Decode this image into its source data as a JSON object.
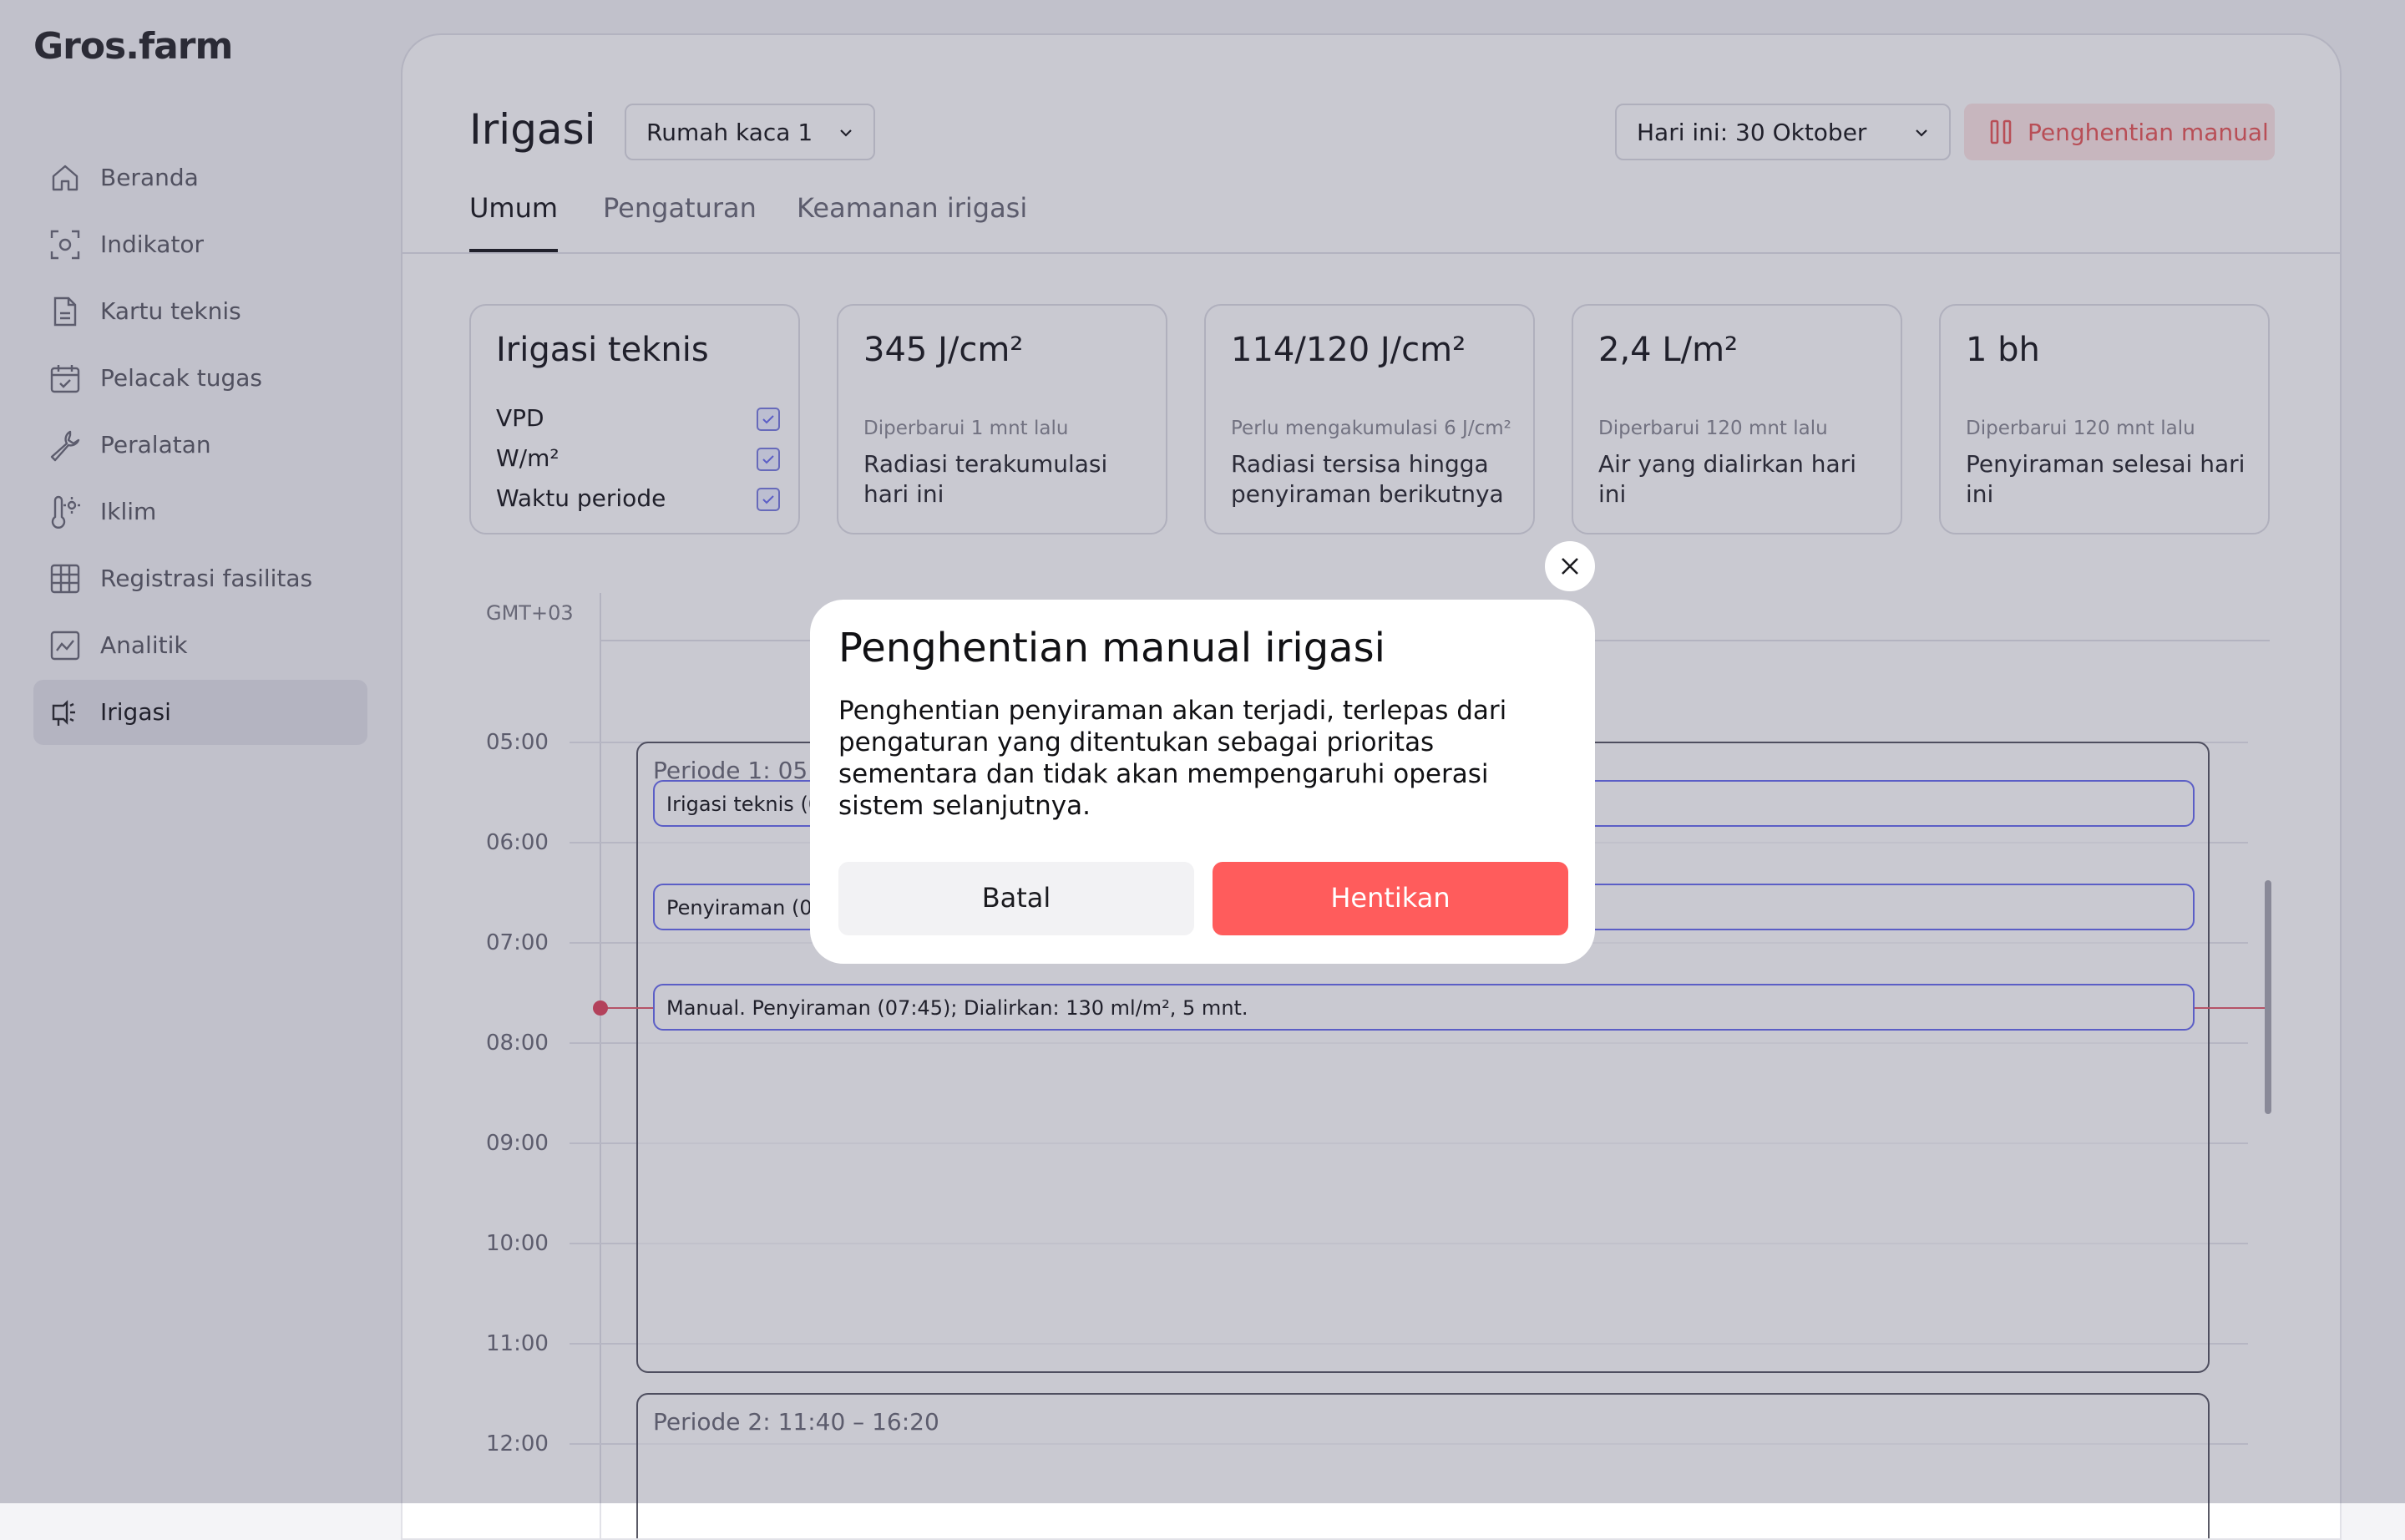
{
  "app": {
    "logo": "Gros.farm"
  },
  "sidebar": {
    "items": [
      {
        "label": "Beranda",
        "icon": "home-icon"
      },
      {
        "label": "Indikator",
        "icon": "sensor-icon"
      },
      {
        "label": "Kartu teknis",
        "icon": "document-icon"
      },
      {
        "label": "Pelacak tugas",
        "icon": "calendar-check-icon"
      },
      {
        "label": "Peralatan",
        "icon": "wrench-icon"
      },
      {
        "label": "Iklim",
        "icon": "thermometer-icon"
      },
      {
        "label": "Registrasi fasilitas",
        "icon": "grid-icon"
      },
      {
        "label": "Analitik",
        "icon": "chart-icon"
      },
      {
        "label": "Irigasi",
        "icon": "sprinkler-icon",
        "active": true
      }
    ]
  },
  "header": {
    "title": "Irigasi",
    "greenhouse_select": "Rumah kaca 1",
    "date_select": "Hari ini: 30 Oktober",
    "manual_stop_label": "Penghentian manual"
  },
  "tabs": [
    {
      "label": "Umum",
      "active": true
    },
    {
      "label": "Pengaturan"
    },
    {
      "label": "Keamanan irigasi"
    }
  ],
  "cards": {
    "tech": {
      "title": "Irigasi teknis",
      "items": [
        {
          "label": "VPD",
          "checked": true
        },
        {
          "label": "W/m²",
          "checked": true
        },
        {
          "label": "Waktu periode",
          "checked": true
        }
      ]
    },
    "stats": [
      {
        "value": "345 J/cm²",
        "sub": "Diperbarui 1 mnt lalu",
        "desc": "Radiasi terakumulasi hari ini"
      },
      {
        "value": "114/120 J/cm²",
        "sub": "Perlu mengakumulasi 6 J/cm²",
        "desc": "Radiasi tersisa hingga penyiraman berikutnya"
      },
      {
        "value": "2,4 L/m²",
        "sub": "Diperbarui 120 mnt lalu",
        "desc": "Air yang dialirkan hari ini"
      },
      {
        "value": "1 bh",
        "sub": "Diperbarui 120 mnt lalu",
        "desc": "Penyiraman selesai hari ini"
      }
    ]
  },
  "timeline": {
    "timezone": "GMT+03",
    "hours": [
      "05:00",
      "06:00",
      "07:00",
      "08:00",
      "09:00",
      "10:00",
      "11:00",
      "12:00"
    ],
    "periods": [
      {
        "label": "Periode 1: 05:0"
      },
      {
        "label": "Periode 2: 11:40 – 16:20"
      }
    ],
    "events": [
      {
        "label": "Irigasi teknis (0"
      },
      {
        "label": "Penyiraman (06"
      },
      {
        "label": "Manual. Penyiraman (07:45); Dialirkan: 130 ml/m², 5 mnt."
      }
    ],
    "now_color": "#e24860"
  },
  "modal": {
    "title": "Penghentian manual irigasi",
    "body": "Penghentian penyiraman akan terjadi, terlepas dari pengaturan yang ditentukan sebagai prioritas sementara dan tidak akan mempengaruhi operasi sistem selanjutnya.",
    "cancel_label": "Batal",
    "confirm_label": "Hentikan",
    "confirm_color": "#ff5c5c"
  }
}
